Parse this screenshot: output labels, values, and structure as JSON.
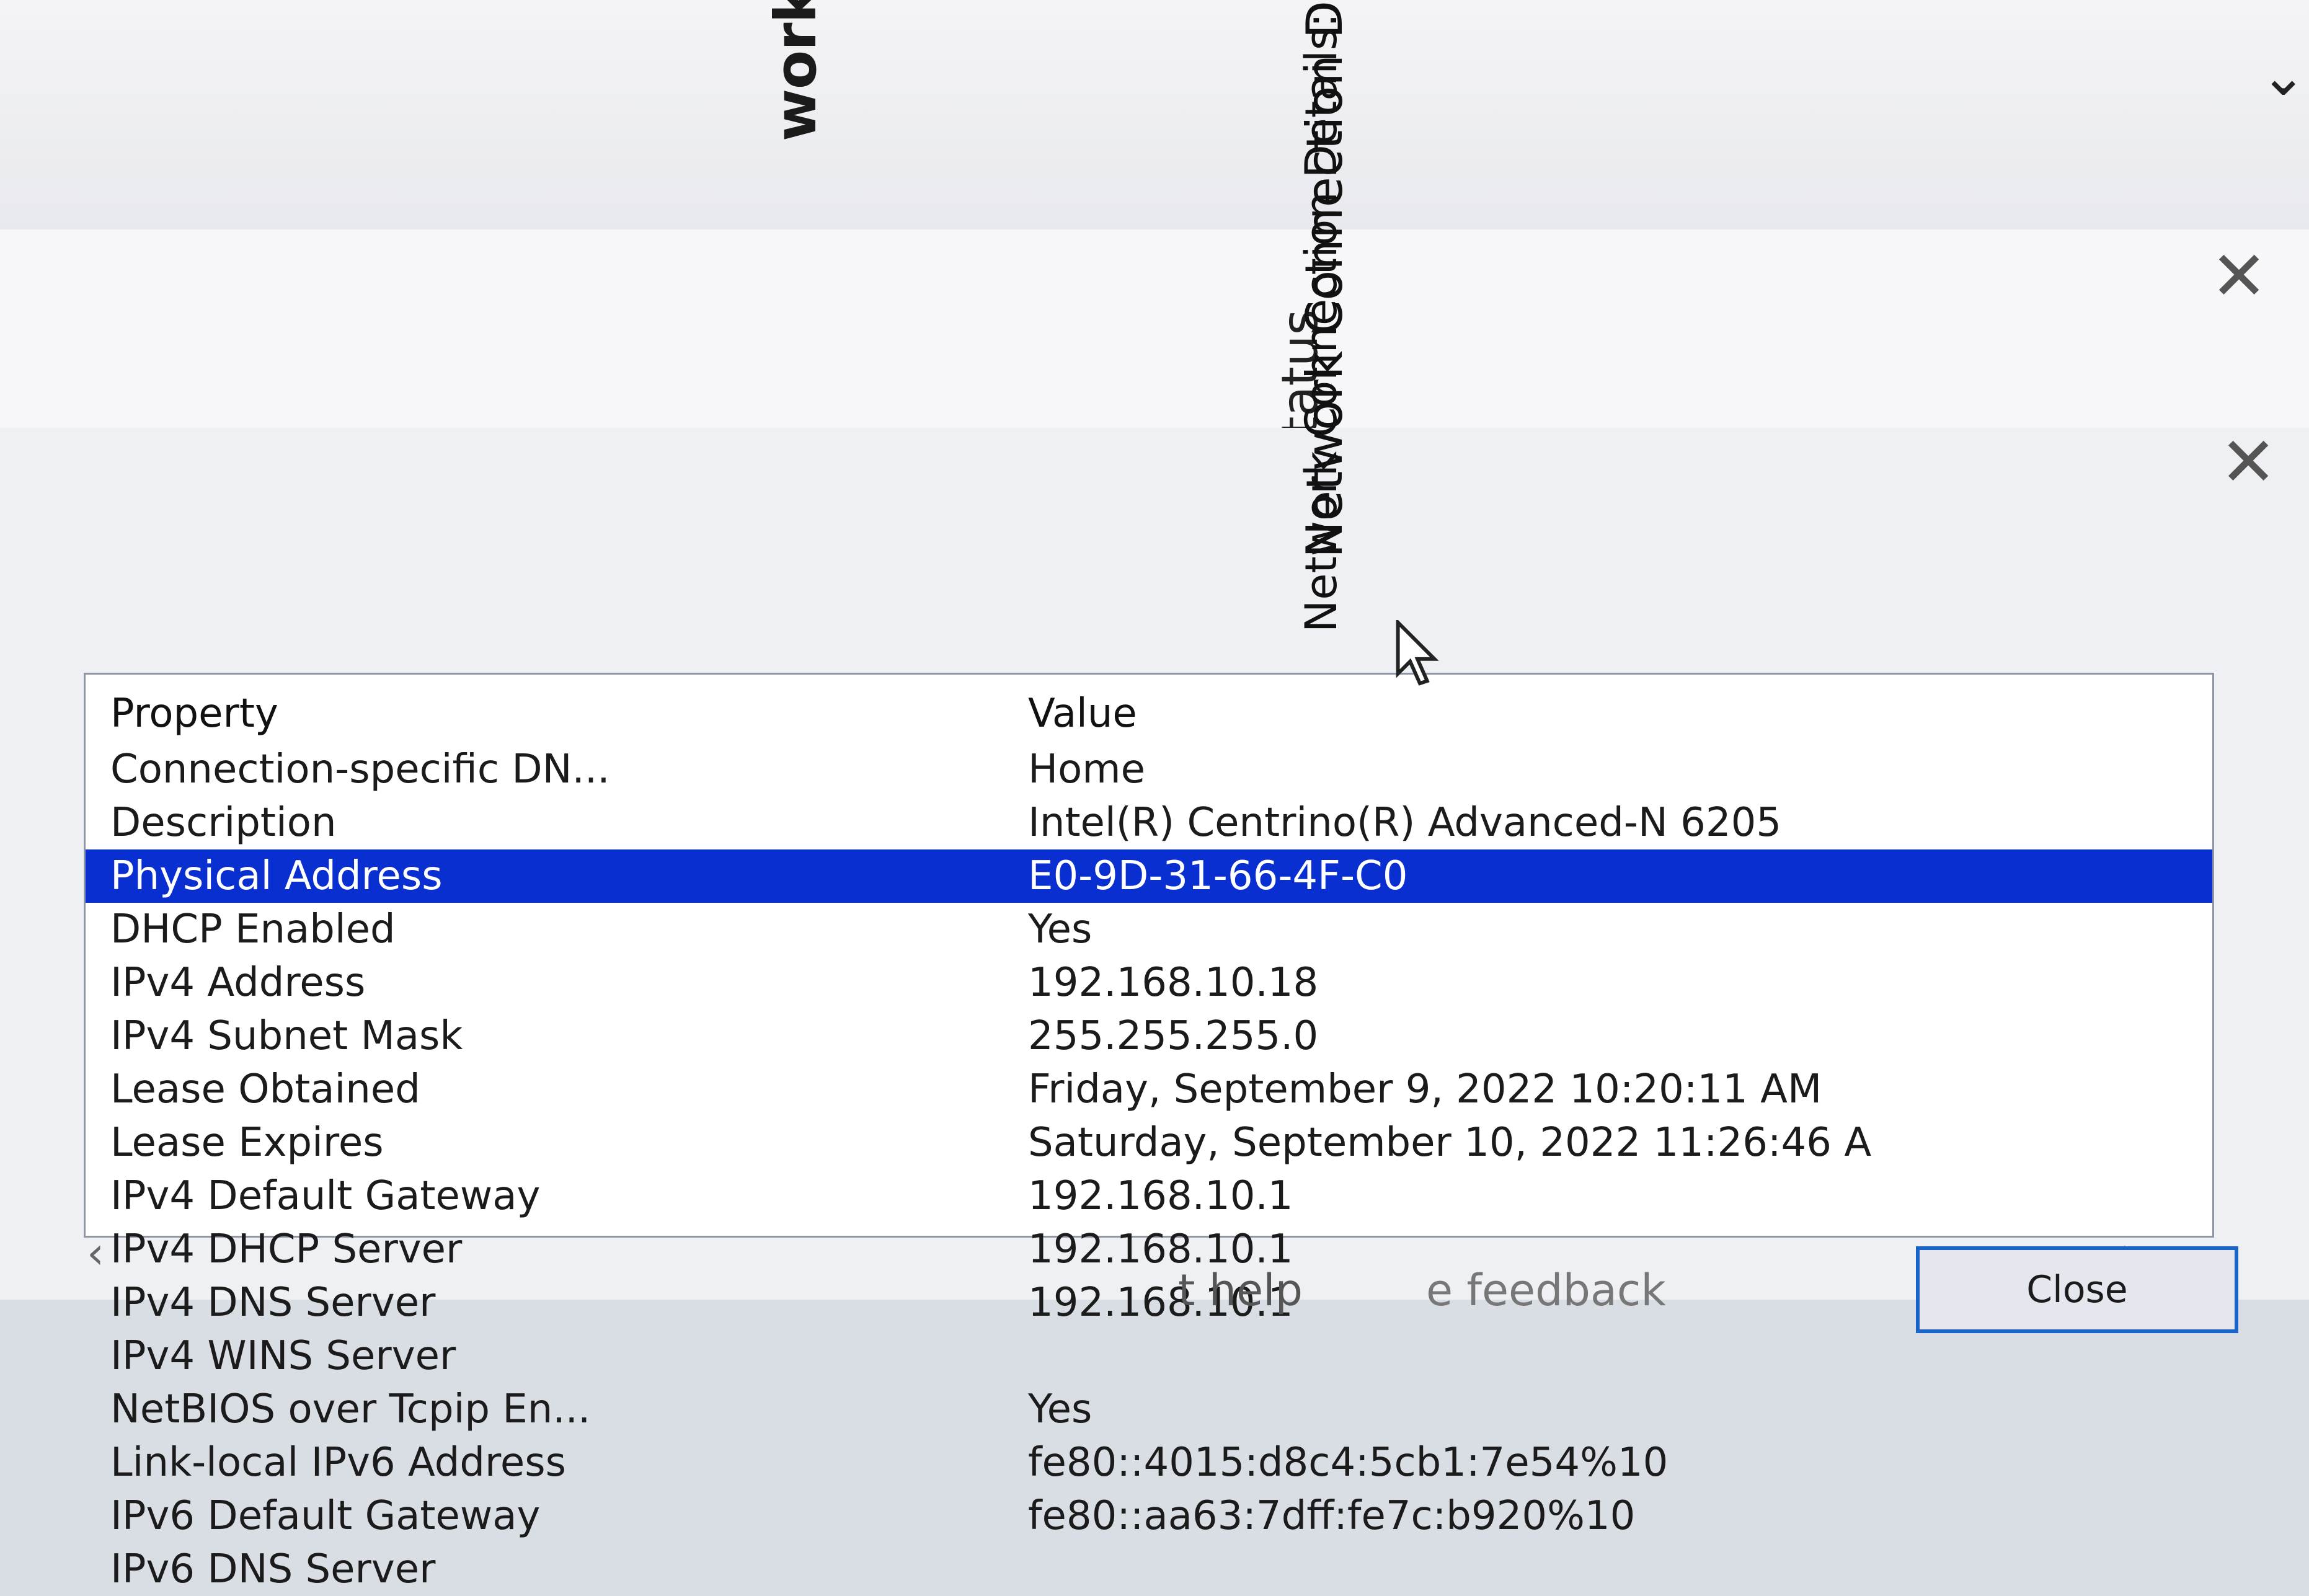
{
  "nsc_window": {
    "title": "work and Sharing Center"
  },
  "wifi_window": {
    "title": "Wi-Fi Status"
  },
  "details_window": {
    "title": "Network Connection Details",
    "section_label": "Network Connection Details:",
    "columns": [
      "Property",
      "Value"
    ],
    "rows": [
      {
        "property": "Connection-specific DN...",
        "value": "Home"
      },
      {
        "property": "Description",
        "value": "Intel(R) Centrino(R) Advanced-N 6205"
      },
      {
        "property": "Physical Address",
        "value": "E0-9D-31-66-4F-C0",
        "selected": true
      },
      {
        "property": "DHCP Enabled",
        "value": "Yes"
      },
      {
        "property": "IPv4 Address",
        "value": "192.168.10.18"
      },
      {
        "property": "IPv4 Subnet Mask",
        "value": "255.255.255.0"
      },
      {
        "property": "Lease Obtained",
        "value": "Friday, September 9, 2022 10:20:11 AM"
      },
      {
        "property": "Lease Expires",
        "value": "Saturday, September 10, 2022 11:26:46 A"
      },
      {
        "property": "IPv4 Default Gateway",
        "value": "192.168.10.1"
      },
      {
        "property": "IPv4 DHCP Server",
        "value": "192.168.10.1"
      },
      {
        "property": "IPv4 DNS Server",
        "value": "192.168.10.1"
      },
      {
        "property": "IPv4 WINS Server",
        "value": ""
      },
      {
        "property": "NetBIOS over Tcpip En...",
        "value": "Yes"
      },
      {
        "property": "Link-local IPv6 Address",
        "value": "fe80::4015:d8c4:5cb1:7e54%10"
      },
      {
        "property": "IPv6 Default Gateway",
        "value": "fe80::aa63:7dff:fe7c:b920%10"
      },
      {
        "property": "IPv6 DNS Server",
        "value": ""
      }
    ],
    "close_button": "Close"
  },
  "background": {
    "help": "t help",
    "feedback": "e feedback"
  },
  "icons": [
    "chevron-down-icon",
    "close-icon",
    "mouse-cursor-icon",
    "scroll-left-icon",
    "scroll-right-icon"
  ],
  "colors": {
    "selection": "#0a2fd1",
    "focus_border": "#1a64c8"
  }
}
